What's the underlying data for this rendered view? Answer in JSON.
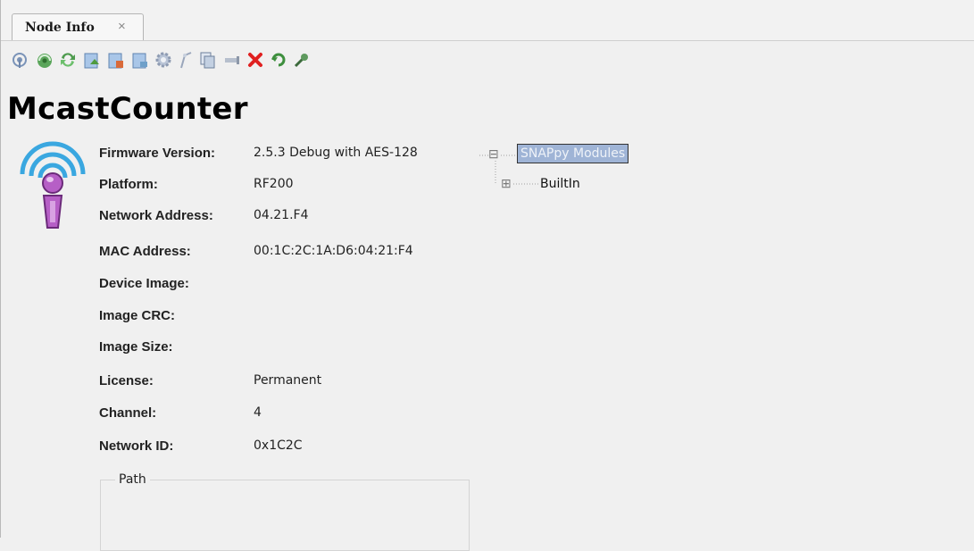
{
  "tab": {
    "title": "Node Info",
    "close_glyph": "×"
  },
  "toolbar": {
    "icons": [
      "ping-icon",
      "refresh-icon",
      "sync-icon",
      "upload-image-icon",
      "upload-image-alt-icon",
      "erase-image-icon",
      "settings-gear-icon",
      "probe-icon",
      "copy-icon",
      "port-icon",
      "delete-icon",
      "reboot-icon",
      "tool-icon"
    ]
  },
  "node": {
    "name": "McastCounter",
    "icon": "wireless-node-icon"
  },
  "properties": [
    {
      "label": "Firmware Version:",
      "value": "2.5.3 Debug with AES-128"
    },
    {
      "label": "Platform:",
      "value": "RF200"
    },
    {
      "label": "Network Address:",
      "value": "04.21.F4"
    },
    {
      "label": "MAC Address:",
      "value": "00:1C:2C:1A:D6:04:21:F4"
    },
    {
      "label": "Device Image:",
      "value": ""
    },
    {
      "label": "Image CRC:",
      "value": ""
    },
    {
      "label": "Image Size:",
      "value": ""
    },
    {
      "label": "License:",
      "value": "Permanent"
    },
    {
      "label": "Channel:",
      "value": "4"
    },
    {
      "label": "Network ID:",
      "value": "0x1C2C"
    }
  ],
  "path": {
    "label": "Path"
  },
  "tree": {
    "root": {
      "label": "SNAPpy Modules",
      "expanded": true,
      "selected": true,
      "toggle_glyph": "⊟"
    },
    "children": [
      {
        "label": "BuiltIn",
        "expanded": false,
        "toggle_glyph": "⊞"
      }
    ]
  }
}
